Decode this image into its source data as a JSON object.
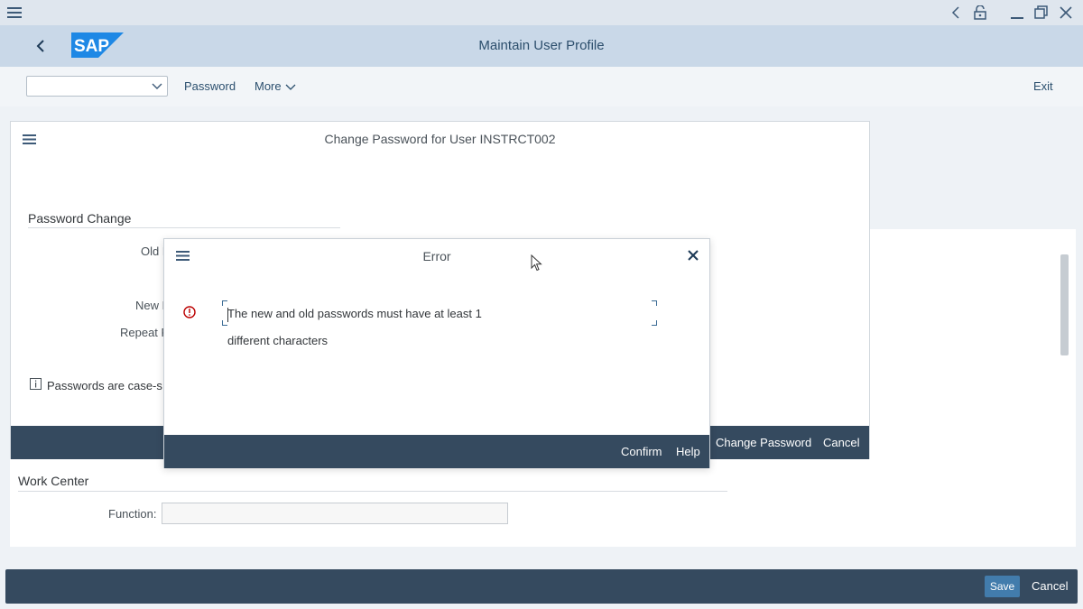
{
  "window": {
    "buttons": [
      "back-arrow",
      "lock-open",
      "minimize",
      "restore",
      "close"
    ]
  },
  "shell": {
    "logo_text": "SAP",
    "title": "Maintain User Profile"
  },
  "toolbar": {
    "command_field_value": "",
    "password_label": "Password",
    "more_label": "More",
    "exit_label": "Exit"
  },
  "panel": {
    "title": "Change Password for User INSTRCT002",
    "group_title": "Password Change",
    "labels": {
      "old": "Old P",
      "new": "New P",
      "repeat": "Repeat P"
    },
    "info_text": "Passwords are case-s",
    "footer": {
      "change_password": "Change Password",
      "cancel": "Cancel"
    }
  },
  "dialog": {
    "title": "Error",
    "message_line1": "The new and old passwords must have at least 1",
    "message_line2": "different characters",
    "confirm": "Confirm",
    "help": "Help"
  },
  "work_center": {
    "title": "Work Center",
    "function_label": "Function:",
    "function_value": ""
  },
  "app_footer": {
    "save": "Save",
    "cancel": "Cancel"
  },
  "colors": {
    "shell_bg": "#c9d8e8",
    "footer_bg": "#354a5f",
    "save_button": "#427cac",
    "error_red": "#bb0000",
    "logo_blue": "#1e88e5"
  }
}
